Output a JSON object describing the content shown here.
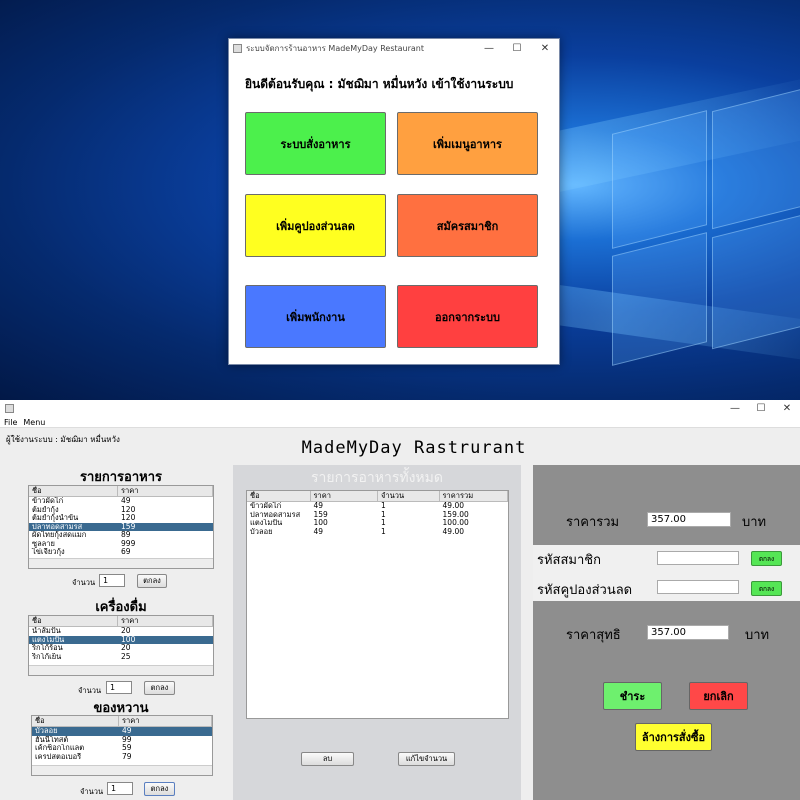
{
  "menu_window": {
    "title": "ระบบจัดการร้านอาหาร MadeMyDay Restaurant",
    "welcome": "ยินดีต้อนรับคุณ :    มัชฌิมา หมื่นหวัง เข้าใช้งานระบบ",
    "buttons": {
      "order": "ระบบสั่งอาหาร",
      "add_menu": "เพิ่มเมนูอาหาร",
      "add_coupon": "เพิ่มคูปองส่วนลด",
      "register_member": "สมัครสมาชิก",
      "add_employee": "เพิ่มพนักงาน",
      "logout": "ออกจากระบบ"
    },
    "colors": {
      "order": "#4cf04c",
      "add_menu": "#ffa040",
      "add_coupon": "#ffff20",
      "register_member": "#ff7040",
      "add_employee": "#4a78ff",
      "logout": "#ff4040"
    }
  },
  "main_window": {
    "menu": {
      "file": "File",
      "menu": "Menu"
    },
    "user_line": "ผู้ใช้งานระบบ :    มัชฌิมา หมื่นหวัง",
    "app_title": "MadeMyDay Rastrurant",
    "food": {
      "title": "รายการอาหาร",
      "columns": [
        "ชื่อ",
        "ราคา"
      ],
      "rows": [
        [
          "ข้าวผัดไก่",
          "49"
        ],
        [
          "ต้มยำกุ้ง",
          "120"
        ],
        [
          "ต้มยำกุ้งน้ำข้น",
          "120"
        ],
        [
          "ปลาทอดสามรส",
          "159"
        ],
        [
          "ผัดไทยกุ้งสดแมก",
          "89"
        ],
        [
          "ซูลลาย",
          "999"
        ],
        [
          "ไข่เจียวกุ้ง",
          "69"
        ]
      ],
      "selected_row": 3,
      "qty_label": "จำนวน",
      "qty_value": "1",
      "ok_label": "ตกลง"
    },
    "drinks": {
      "title": "เครื่องดื่ม",
      "columns": [
        "ชื่อ",
        "ราคา"
      ],
      "rows": [
        [
          "น้ำส้มปั่น",
          "20"
        ],
        [
          "แตงโมปั่น",
          "100"
        ],
        [
          "ริกโก้ร้อน",
          "20"
        ],
        [
          "ริกโก้เย็น",
          "25"
        ]
      ],
      "selected_row": 1,
      "qty_label": "จำนวน",
      "qty_value": "1",
      "ok_label": "ตกลง"
    },
    "desserts": {
      "title": "ของหวาน",
      "columns": [
        "ชื่อ",
        "ราคา"
      ],
      "rows": [
        [
          "บัวลอย",
          "49"
        ],
        [
          "ฮันนี่โทสต์",
          "99"
        ],
        [
          "เค้กช็อกโกแลต",
          "59"
        ],
        [
          "เครปสตอเบอรี่",
          "79"
        ]
      ],
      "selected_row": 0,
      "qty_label": "จำนวน",
      "qty_value": "1",
      "ok_label": "ตกลง"
    },
    "order_list": {
      "title": "รายการอาหารทั้งหมด",
      "columns": [
        "ชื่อ",
        "ราคา",
        "จำนวน",
        "ราคารวม"
      ],
      "rows": [
        [
          "ข้าวผัดไก่",
          "49",
          "1",
          "49.00"
        ],
        [
          "ปลาทอดสามรส",
          "159",
          "1",
          "159.00"
        ],
        [
          "แตงโมปั่น",
          "100",
          "1",
          "100.00"
        ],
        [
          "บัวลอย",
          "49",
          "1",
          "49.00"
        ]
      ],
      "delete_label": "ลบ",
      "edit_qty_label": "แก้ไขจำนวน"
    },
    "summary": {
      "total_label": "ราคารวม",
      "total_value": "357.00",
      "baht": "บาท",
      "member_label": "รหัสสมาชิก",
      "member_value": "",
      "coupon_label": "รหัสคูปองส่วนลด",
      "coupon_value": "",
      "ok_label": "ตกลง",
      "net_label": "ราคาสุทธิ",
      "net_value": "357.00",
      "pay_label": "ชำระ",
      "cancel_label": "ยกเลิก",
      "clear_label": "ล้างการสั่งซื้อ"
    }
  }
}
